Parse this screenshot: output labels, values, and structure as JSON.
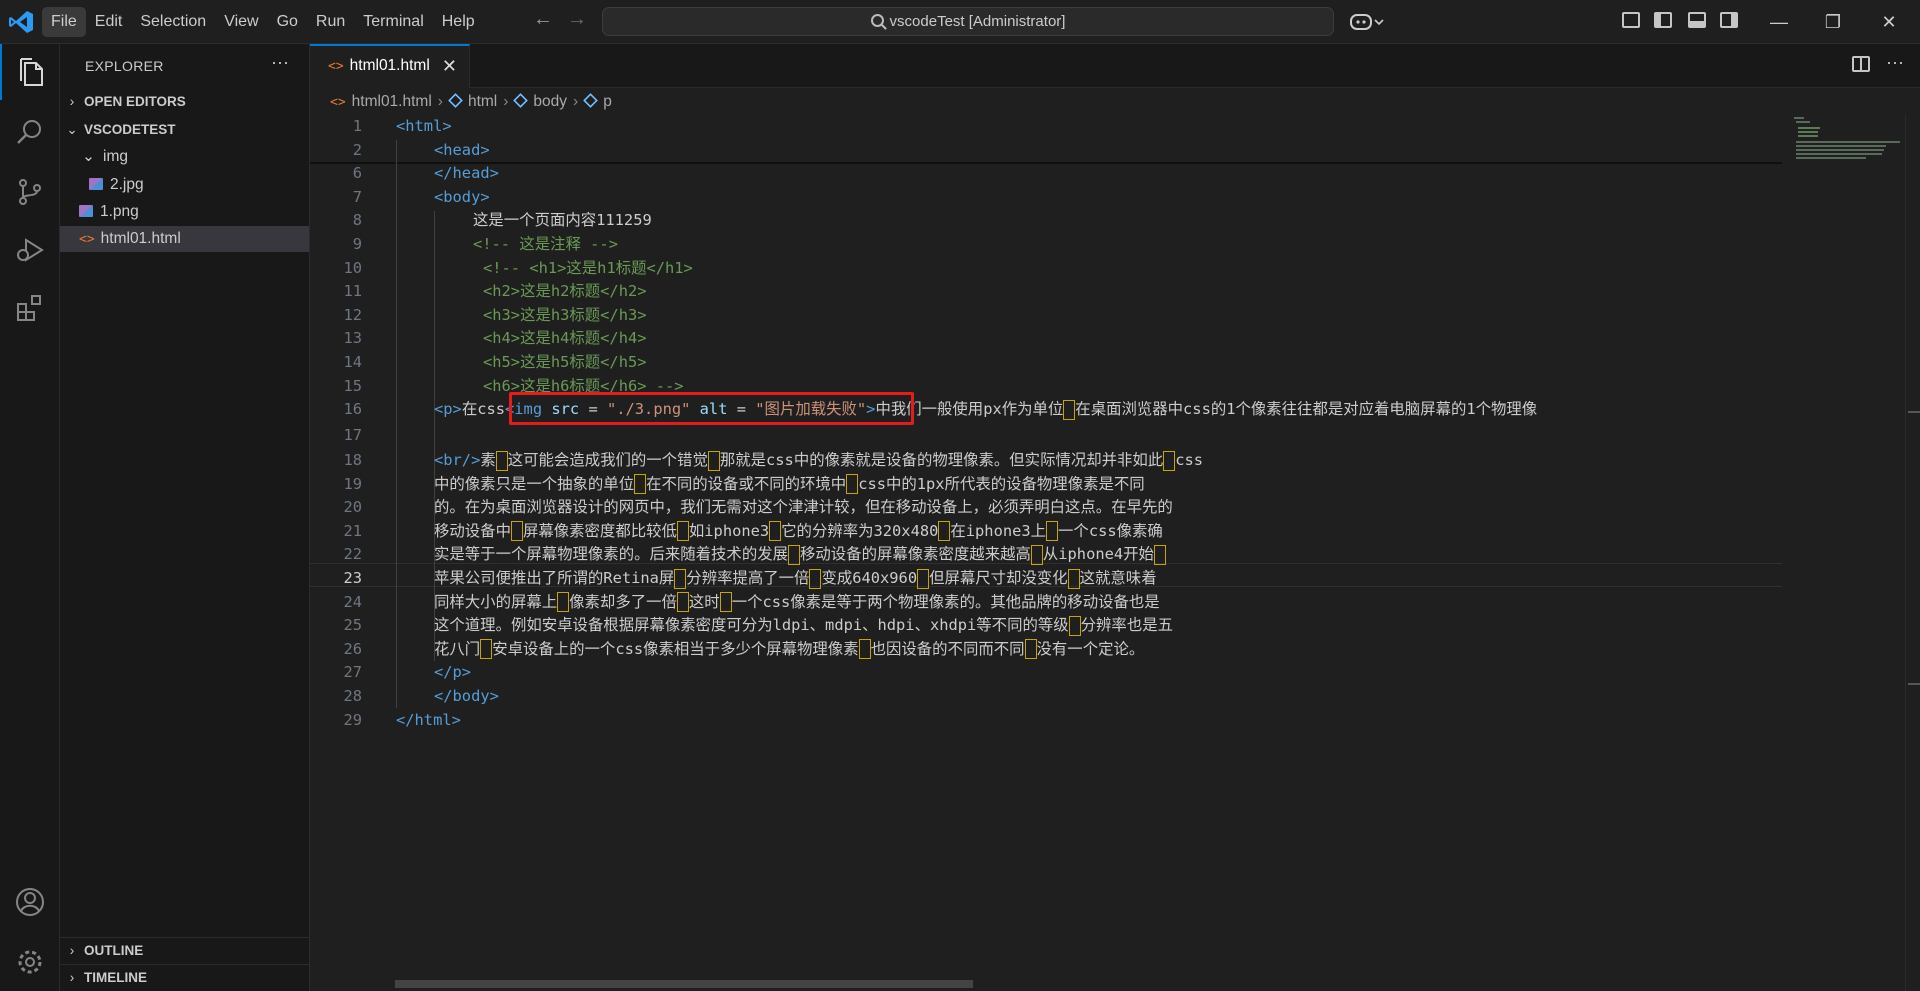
{
  "titlebar": {
    "menu": [
      "File",
      "Edit",
      "Selection",
      "View",
      "Go",
      "Run",
      "Terminal",
      "Help"
    ],
    "command_center": "vscodeTest [Administrator]",
    "window_controls": [
      "minimize",
      "restore",
      "close"
    ]
  },
  "sidebar": {
    "header": "EXPLORER",
    "more": "···",
    "sections": {
      "open_editors": "OPEN EDITORS",
      "project": "VSCODETEST",
      "outline": "OUTLINE",
      "timeline": "TIMELINE"
    },
    "tree": [
      {
        "label": "img",
        "type": "folder"
      },
      {
        "label": "2.jpg",
        "type": "image"
      },
      {
        "label": "1.png",
        "type": "image"
      },
      {
        "label": "html01.html",
        "type": "html",
        "selected": true
      }
    ]
  },
  "editor": {
    "tab_label": "html01.html",
    "tab_close": "✕",
    "breadcrumb": [
      "html01.html",
      "html",
      "body",
      "p"
    ],
    "current_line": 23,
    "line_numbers": [
      "1",
      "2",
      "6",
      "7",
      "8",
      "9",
      "10",
      "11",
      "12",
      "13",
      "14",
      "15",
      "16",
      "17",
      "18",
      "19",
      "20",
      "21",
      "22",
      "23",
      "24",
      "25",
      "26",
      "27",
      "28",
      "29"
    ],
    "code": {
      "l1": "<html>",
      "l2": "<head>",
      "l6": "</head>",
      "l7": "<body>",
      "l8": "这是一个页面内容111259",
      "l9": "<!-- 这是注释 -->",
      "l10": "<!-- <h1>这是h1标题</h1>",
      "l11": "<h2>这是h2标题</h2>",
      "l12": "<h3>这是h3标题</h3>",
      "l13": "<h4>这是h4标题</h4>",
      "l14": "<h5>这是h5标题</h5>",
      "l15": "<h6>这是h6标题</h6> -->",
      "l16_p_open": "<p>",
      "l16_text1": "在css",
      "l16_img_open": "<img",
      "l16_src_attr": " src",
      "l16_eq1": " = ",
      "l16_src_val": "\"./3.png\"",
      "l16_alt_attr": " alt",
      "l16_eq2": " = ",
      "l16_alt_val": "\"图片加载失败\"",
      "l16_img_close": ">",
      "l16_text2": "中我们一般使用px作为单位",
      "l16_text3": "在桌面浏览器中css的1个像素往往都是对应着电脑屏幕的1个物理像",
      "l18_br": "<br/>",
      "l18_a": "素",
      "l18_b": "这可能会造成我们的一个错觉",
      "l18_c": "那就是css中的像素就是设备的物理像素。但实际情况却并非如此",
      "l18_d": "css",
      "l19_a": "中的像素只是一个抽象的单位",
      "l19_b": "在不同的设备或不同的环境中",
      "l19_c": "css中的1px所代表的设备物理像素是不同",
      "l20": "的。在为桌面浏览器设计的网页中，我们无需对这个津津计较，但在移动设备上，必须弄明白这点。在早先的",
      "l21_a": "移动设备中",
      "l21_b": "屏幕像素密度都比较低",
      "l21_c": "如iphone3",
      "l21_d": "它的分辨率为320x480",
      "l21_e": "在iphone3上",
      "l21_f": "一个css像素确",
      "l22_a": "实是等于一个屏幕物理像素的。后来随着技术的发展",
      "l22_b": "移动设备的屏幕像素密度越来越高",
      "l22_c": "从iphone4开始",
      "l23_a": "苹果公司便推出了所谓的Retina屏",
      "l23_b": "分辨率提高了一倍",
      "l23_c": "变成640x960",
      "l23_d": "但屏幕尺寸却没变化",
      "l23_e": "这就意味着",
      "l24_a": "同样大小的屏幕上",
      "l24_b": "像素却多了一倍",
      "l24_c": "这时",
      "l24_d": "一个css像素是等于两个物理像素的。其他品牌的移动设备也是",
      "l25_a": "这个道理。例如安卓设备根据屏幕像素密度可分为ldpi、mdpi、hdpi、xhdpi等不同的等级",
      "l25_b": "分辨率也是五",
      "l26_a": "花八门",
      "l26_b": "安卓设备上的一个css像素相当于多少个屏幕物理像素",
      "l26_c": "也因设备的不同而不同",
      "l26_d": "没有一个定论。",
      "l27": "</p>",
      "l28": "</body>",
      "l29": "</html>"
    }
  },
  "colors": {
    "accent": "#0078d4",
    "highlight_box": "#e51c1c",
    "tag": "#569cd6",
    "attr": "#9cdcfe",
    "string": "#ce9178",
    "comment": "#6a9955",
    "punct_highlight": "#c8a400"
  }
}
